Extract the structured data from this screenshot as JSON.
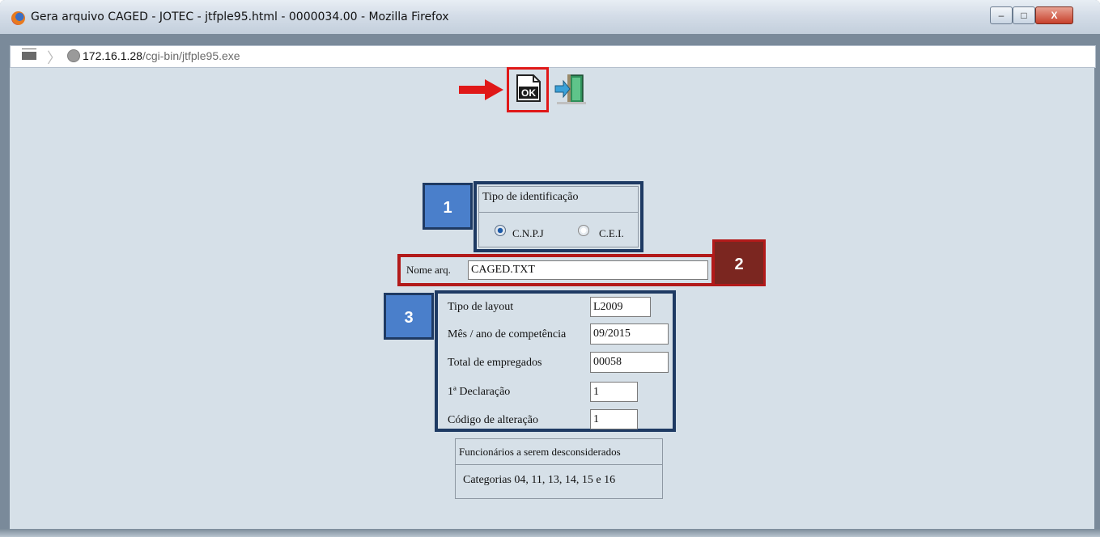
{
  "window": {
    "title": "Gera arquivo CAGED - JOTEC - jtfple95.html - 0000034.00 - Mozilla Firefox",
    "controls": {
      "minimize": "–",
      "maximize": "□",
      "close": "X"
    }
  },
  "address": {
    "host": "172.16.1.28",
    "path": "/cgi-bin/jtfple95.exe"
  },
  "toolbar": {
    "ok_label": "OK"
  },
  "badges": {
    "one": "1",
    "two": "2",
    "three": "3"
  },
  "tipo_identificacao": {
    "legend": "Tipo de identificação",
    "options": [
      {
        "label": "C.N.P.J",
        "checked": true
      },
      {
        "label": "C.E.I.",
        "checked": false
      }
    ]
  },
  "nome_arq": {
    "label": "Nome arq.",
    "value": "CAGED.TXT"
  },
  "form": {
    "tipo_layout": {
      "label": "Tipo de layout",
      "value": "L2009"
    },
    "mes_ano": {
      "label": "Mês / ano de competência",
      "value": "09/2015"
    },
    "total_empregados": {
      "label": "Total de empregados",
      "value": "00058"
    },
    "primeira_declaracao": {
      "label": "1ª Declaração",
      "value": "1"
    },
    "codigo_alteracao": {
      "label": "Código de alteração",
      "value": "1"
    }
  },
  "funcionarios": {
    "legend": "Funcionários a serem desconsiderados",
    "text": "Categorias 04, 11, 13, 14, 15 e 16"
  },
  "colors": {
    "highlight_red": "#e01818",
    "frame_blue": "#1e3a63",
    "badge_blue": "#4a7fcb",
    "badge_red": "#7b2620"
  }
}
